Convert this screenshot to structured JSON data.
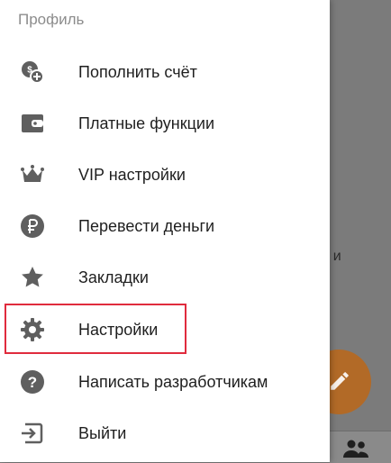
{
  "drawer": {
    "header": "Профиль",
    "items": [
      {
        "label": "Пополнить счёт",
        "icon": "coins-icon"
      },
      {
        "label": "Платные функции",
        "icon": "wallet-icon"
      },
      {
        "label": "VIP настройки",
        "icon": "crown-icon"
      },
      {
        "label": "Перевести деньги",
        "icon": "ruble-icon"
      },
      {
        "label": "Закладки",
        "icon": "star-icon"
      },
      {
        "label": "Настройки",
        "icon": "gear-icon"
      },
      {
        "label": "Написать разработчикам",
        "icon": "question-icon"
      },
      {
        "label": "Выйти",
        "icon": "logout-icon"
      }
    ],
    "highlighted_item": "Настройки"
  },
  "background": {
    "partial_text": "о, и"
  },
  "colors": {
    "icon": "#5f5f5f",
    "highlight": "#e02b3d",
    "fab": "#b26a27",
    "overlay": "#7b7b7b"
  }
}
